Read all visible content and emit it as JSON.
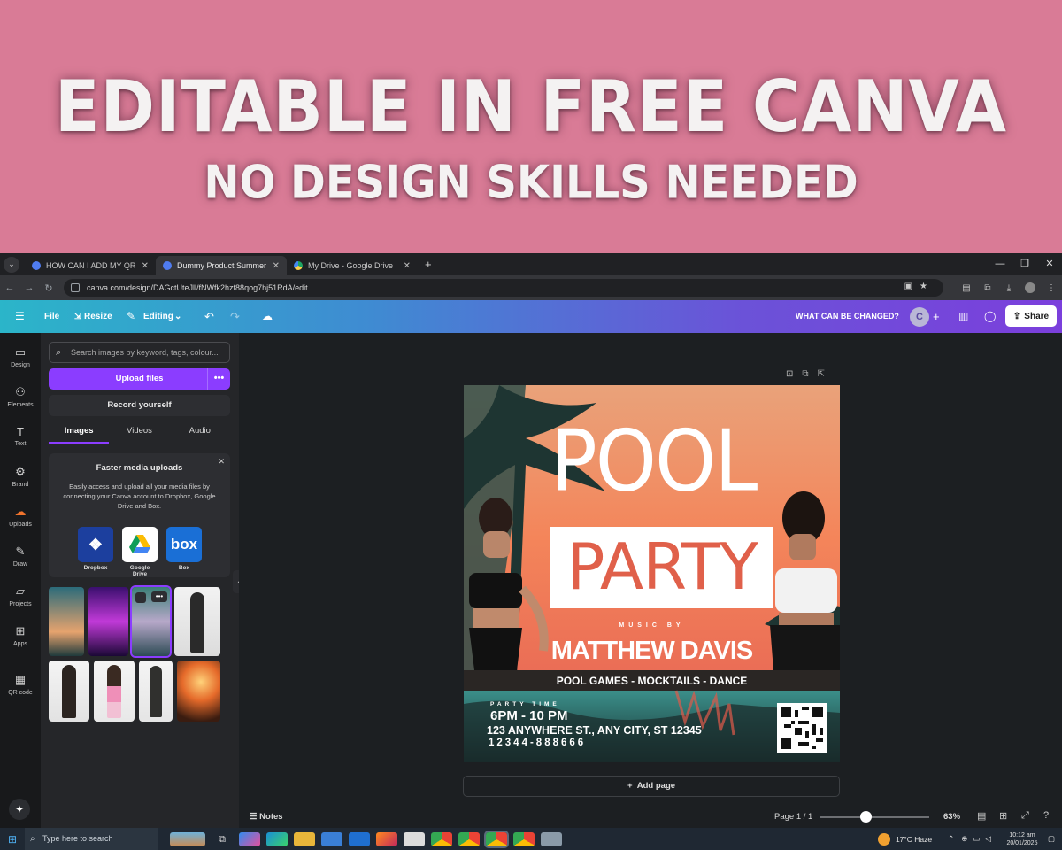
{
  "banner": {
    "title": "EDITABLE IN FREE CANVA",
    "subtitle": "NO DESIGN SKILLS NEEDED"
  },
  "browser": {
    "tabs": [
      {
        "title": "HOW CAN I ADD MY QR CODE",
        "active": false
      },
      {
        "title": "Dummy Product Summer Vibe",
        "active": true
      },
      {
        "title": "My Drive - Google Drive",
        "active": false
      }
    ],
    "url": "canva.com/design/DAGctUteJll/fNWfk2hzf88qog7hj51RdA/edit"
  },
  "canva_header": {
    "menu": [
      "File",
      "Resize",
      "Editing"
    ],
    "title": "WHAT CAN BE CHANGED?",
    "avatar_letter": "C",
    "share_label": "Share"
  },
  "rail": [
    {
      "label": "Design",
      "icon": "design-icon",
      "glyph": "▭"
    },
    {
      "label": "Elements",
      "icon": "elements-icon",
      "glyph": "⚇"
    },
    {
      "label": "Text",
      "icon": "text-icon",
      "glyph": "T"
    },
    {
      "label": "Brand",
      "icon": "brand-icon",
      "glyph": "⚙"
    },
    {
      "label": "Uploads",
      "icon": "uploads-icon",
      "glyph": "☁"
    },
    {
      "label": "Draw",
      "icon": "draw-icon",
      "glyph": "✎"
    },
    {
      "label": "Projects",
      "icon": "projects-icon",
      "glyph": "▱"
    },
    {
      "label": "Apps",
      "icon": "apps-icon",
      "glyph": "⊞"
    },
    {
      "label": "QR code",
      "icon": "qr-code-icon",
      "glyph": "▦"
    }
  ],
  "panel": {
    "search_placeholder": "Search images by keyword, tags, colour...",
    "upload_label": "Upload files",
    "record_label": "Record yourself",
    "tabs": [
      "Images",
      "Videos",
      "Audio"
    ],
    "card": {
      "title": "Faster media uploads",
      "body": "Easily access and upload all your media files by connecting your Canva account to Dropbox, Google Drive and Box.",
      "services": [
        "Dropbox",
        "Google Drive",
        "Box"
      ]
    }
  },
  "flyer": {
    "line1": "POOL",
    "line2": "PARTY",
    "music_by": "MUSIC BY",
    "artist": "MATTHEW DAVIS",
    "activities": "POOL GAMES - MOCKTAILS - DANCE",
    "party_time": "PARTY TIME",
    "time": "6PM - 10 PM",
    "address": "123 ANYWHERE ST., ANY CITY, ST 12345",
    "phone": "12344-888666"
  },
  "canvas": {
    "add_page": "Add page"
  },
  "status": {
    "notes": "Notes",
    "page": "Page 1 / 1",
    "zoom": "63%",
    "zoom_level": 0.42
  },
  "taskbar": {
    "search_placeholder": "Type here to search",
    "weather": "17°C  Haze",
    "time": "10:12 am",
    "date": "20/01/2025"
  }
}
